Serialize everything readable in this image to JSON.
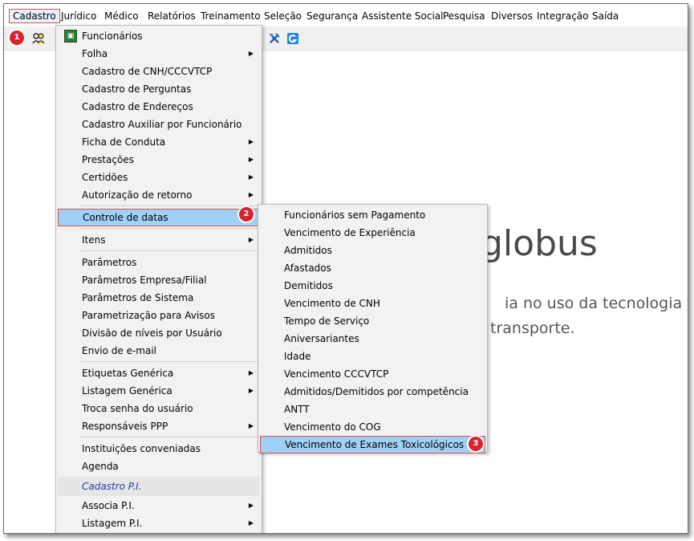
{
  "menubar": {
    "items": [
      "Cadastro",
      "Jurídico",
      "Médico",
      "Relatórios",
      "Treinamento",
      "Seleção",
      "Segurança",
      "Assistente Social",
      "Pesquisa",
      "Diversos",
      "Integração",
      "Saída"
    ]
  },
  "toolbar": {
    "icons": [
      "people-icon",
      "tools-icon",
      "globus-g-icon"
    ]
  },
  "background": {
    "brand": "globus",
    "tagline_line1": "ia no uso da tecnologia",
    "tagline_line2": "transporte."
  },
  "cadastro_menu": {
    "items": [
      "Funcionários",
      "Folha",
      "Cadastro de CNH/CCCVTCP",
      "Cadastro de Perguntas",
      "Cadastro de Endereços",
      "Cadastro Auxiliar por Funcionário",
      "Ficha de Conduta",
      "Prestações",
      "Certidões",
      "Autorização de retorno",
      "Controle de datas",
      "Itens",
      "Parâmetros",
      "Parâmetros Empresa/Filial",
      "Parâmetros de Sistema",
      "Parametrização para Avisos",
      "Divisão de níveis por Usuário",
      "Envio de e-mail",
      "Etiquetas Genérica",
      "Listagem Genérica",
      "Troca senha do usuário",
      "Responsáveis PPP",
      "Instituições conveniadas",
      "Agenda",
      "Cadastro P.I.",
      "Associa P.I.",
      "Listagem P.I."
    ]
  },
  "controle_datas_submenu": {
    "items": [
      "Funcionários sem Pagamento",
      "Vencimento de Experiência",
      "Admitidos",
      "Afastados",
      "Demitidos",
      "Vencimento de CNH",
      "Tempo de Serviço",
      "Aniversariantes",
      "Idade",
      "Vencimento CCCVTCP",
      "Admitidos/Demitidos por competência",
      "ANTT",
      "Vencimento do COG",
      "Vencimento de Exames Toxicológicos"
    ]
  },
  "badges": [
    "1",
    "2",
    "3"
  ],
  "colors": {
    "highlight": "#9fd0f5",
    "badge": "#d9232e",
    "outline": "#d9534f"
  }
}
